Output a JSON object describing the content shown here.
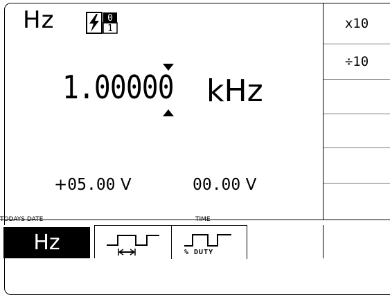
{
  "mode": {
    "label": "Hz"
  },
  "display": {
    "value": "1.00000",
    "unit": "kHz"
  },
  "voltages": {
    "left_sign": "+",
    "left_value": "05.00",
    "left_unit": "V",
    "right_value": "00.00",
    "right_unit": "V"
  },
  "labels": {
    "date": "TODAYS DATE",
    "time": "TIME"
  },
  "softkeys": [
    {
      "label": "x10"
    },
    {
      "label": "÷10"
    },
    {
      "label": ""
    },
    {
      "label": ""
    },
    {
      "label": ""
    },
    {
      "label": ""
    }
  ],
  "tabs": {
    "hz": "Hz",
    "duty": "% DUTY"
  },
  "icons": {
    "mode_icon": "lightning-01-icon",
    "period_icon": "pulse-period-icon",
    "duty_icon": "pulse-duty-icon"
  }
}
